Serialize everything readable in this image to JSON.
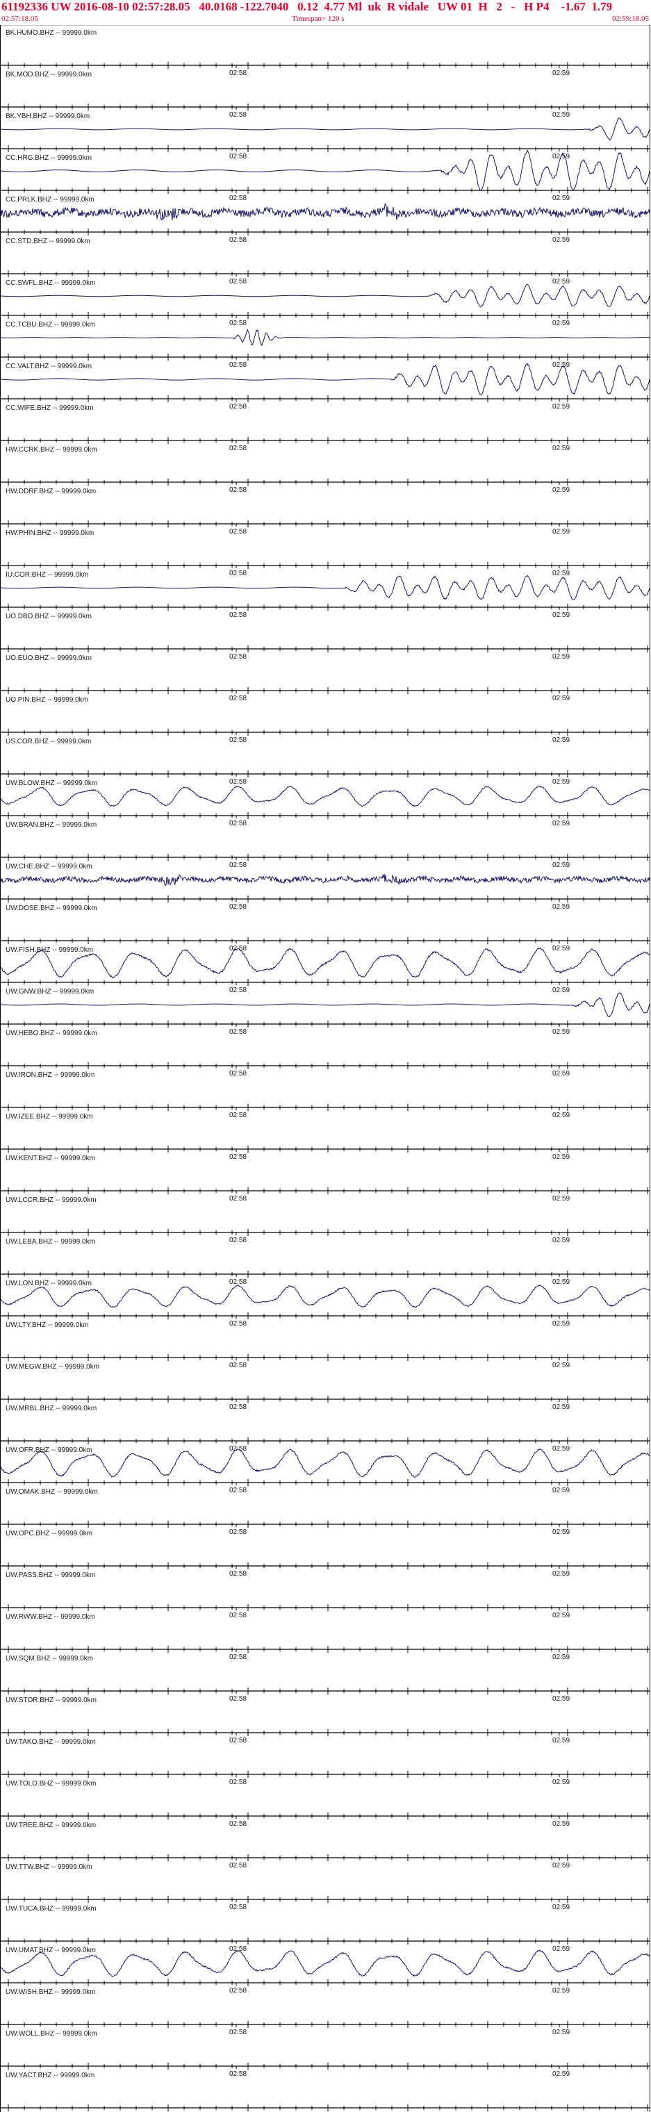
{
  "header": {
    "title": "61192336 UW 2016-08-10 02:57:28.05   40.0168 -122.7040   0.12  4.77 Ml  uk  R vidale   UW 01  H   2   -   H P4    -1.67  1.79",
    "start_time": "02:57:18.05",
    "timespan": "Timespan= 120 s",
    "end_time": "02:59:18.05"
  },
  "time_labels": [
    "02:58",
    "02:59"
  ],
  "colors": {
    "trace": "#141466",
    "header_text": "#e8002a",
    "axis": "#000000"
  },
  "channels": [
    {
      "label": "BK.HUMO.BHZ -- 99999.0km",
      "trace": "none",
      "amp": 0,
      "onset": 1.0
    },
    {
      "label": "BK.MOD.BHZ -- 99999.0km",
      "trace": "none",
      "amp": 0,
      "onset": 1.0
    },
    {
      "label": "BK.YBH.BHZ -- 99999.0km",
      "trace": "wave",
      "amp": 0.55,
      "onset": 0.9
    },
    {
      "label": "CC.HRG.BHZ -- 99999.0km",
      "trace": "wave",
      "amp": 0.9,
      "onset": 0.68
    },
    {
      "label": "CC.PRLK.BHZ -- 99999.0km",
      "trace": "noise",
      "amp": 0.45,
      "onset": 1.0
    },
    {
      "label": "CC.STD.BHZ -- 99999.0km",
      "trace": "none",
      "amp": 0,
      "onset": 1.0
    },
    {
      "label": "CC.SWFL.BHZ -- 99999.0km",
      "trace": "wave",
      "amp": 0.5,
      "onset": 0.66
    },
    {
      "label": "CC.TCBU.BHZ -- 99999.0km",
      "trace": "burst",
      "amp": 0.5,
      "onset": 0.36
    },
    {
      "label": "CC.VALT.BHZ -- 99999.0km",
      "trace": "wave",
      "amp": 0.7,
      "onset": 0.6
    },
    {
      "label": "CC.WIFE.BHZ -- 99999.0km",
      "trace": "none",
      "amp": 0,
      "onset": 1.0
    },
    {
      "label": "HW.CCRK.BHZ -- 99999.0km",
      "trace": "none",
      "amp": 0,
      "onset": 1.0
    },
    {
      "label": "HW.DDRF.BHZ -- 99999.0km",
      "trace": "none",
      "amp": 0,
      "onset": 1.0
    },
    {
      "label": "HW.PHIN.BHZ -- 99999.0km",
      "trace": "none",
      "amp": 0,
      "onset": 1.0
    },
    {
      "label": "IU.COR.BHZ -- 99999.0km",
      "trace": "wave",
      "amp": 0.55,
      "onset": 0.53
    },
    {
      "label": "UO.DBO.BHZ -- 99999.0km",
      "trace": "none",
      "amp": 0,
      "onset": 1.0
    },
    {
      "label": "UO.EUO.BHZ -- 99999.0km",
      "trace": "none",
      "amp": 0,
      "onset": 1.0
    },
    {
      "label": "UO.PIN.BHZ -- 99999.0km",
      "trace": "none",
      "amp": 0,
      "onset": 1.0
    },
    {
      "label": "US.COR.BHZ -- 99999.0km",
      "trace": "none",
      "amp": 0,
      "onset": 1.0
    },
    {
      "label": "UW.BLOW.BHZ -- 99999.0km",
      "trace": "micro",
      "amp": 0.55,
      "onset": 0.0
    },
    {
      "label": "UW.BRAN.BHZ -- 99999.0km",
      "trace": "none",
      "amp": 0,
      "onset": 1.0
    },
    {
      "label": "UW.CHE.BHZ -- 99999.0km",
      "trace": "noise",
      "amp": 0.3,
      "onset": 1.0
    },
    {
      "label": "UW.DOSE.BHZ -- 99999.0km",
      "trace": "none",
      "amp": 0,
      "onset": 1.0
    },
    {
      "label": "UW.FISH.BHZ -- 99999.0km",
      "trace": "micro",
      "amp": 0.8,
      "onset": 0.0
    },
    {
      "label": "UW.GNW.BHZ -- 99999.0km",
      "trace": "wave",
      "amp": 0.6,
      "onset": 0.88
    },
    {
      "label": "UW.HEBO.BHZ -- 99999.0km",
      "trace": "none",
      "amp": 0,
      "onset": 1.0
    },
    {
      "label": "UW.IRON.BHZ -- 99999.0km",
      "trace": "none",
      "amp": 0,
      "onset": 1.0
    },
    {
      "label": "UW.IZEE.BHZ -- 99999.0km",
      "trace": "none",
      "amp": 0,
      "onset": 1.0
    },
    {
      "label": "UW.KENT.BHZ -- 99999.0km",
      "trace": "none",
      "amp": 0,
      "onset": 1.0
    },
    {
      "label": "UW.LCCR.BHZ -- 99999.0km",
      "trace": "none",
      "amp": 0,
      "onset": 1.0
    },
    {
      "label": "UW.LEBA.BHZ -- 99999.0km",
      "trace": "none",
      "amp": 0,
      "onset": 1.0
    },
    {
      "label": "UW.LON.BHZ -- 99999.0km",
      "trace": "micro",
      "amp": 0.6,
      "onset": 0.0
    },
    {
      "label": "UW.LTY.BHZ -- 99999.0km",
      "trace": "none",
      "amp": 0,
      "onset": 1.0
    },
    {
      "label": "UW.MEGW.BHZ -- 99999.0km",
      "trace": "none",
      "amp": 0,
      "onset": 1.0
    },
    {
      "label": "UW.MRBL.BHZ -- 99999.0km",
      "trace": "none",
      "amp": 0,
      "onset": 1.0
    },
    {
      "label": "UW.OFR.BHZ -- 99999.0km",
      "trace": "micro",
      "amp": 0.75,
      "onset": 0.0
    },
    {
      "label": "UW.OMAK.BHZ -- 99999.0km",
      "trace": "none",
      "amp": 0,
      "onset": 1.0
    },
    {
      "label": "UW.OPC.BHZ -- 99999.0km",
      "trace": "none",
      "amp": 0,
      "onset": 1.0
    },
    {
      "label": "UW.PASS.BHZ -- 99999.0km",
      "trace": "none",
      "amp": 0,
      "onset": 1.0
    },
    {
      "label": "UW.RWW.BHZ -- 99999.0km",
      "trace": "none",
      "amp": 0,
      "onset": 1.0
    },
    {
      "label": "UW.SQM.BHZ -- 99999.0km",
      "trace": "none",
      "amp": 0,
      "onset": 1.0
    },
    {
      "label": "UW.STOR.BHZ -- 99999.0km",
      "trace": "none",
      "amp": 0,
      "onset": 1.0
    },
    {
      "label": "UW.TAKO.BHZ -- 99999.0km",
      "trace": "none",
      "amp": 0,
      "onset": 1.0
    },
    {
      "label": "UW.TOLO.BHZ -- 99999.0km",
      "trace": "none",
      "amp": 0,
      "onset": 1.0
    },
    {
      "label": "UW.TREE.BHZ -- 99999.0km",
      "trace": "none",
      "amp": 0,
      "onset": 1.0
    },
    {
      "label": "UW.TTW.BHZ -- 99999.0km",
      "trace": "none",
      "amp": 0,
      "onset": 1.0
    },
    {
      "label": "UW.TUCA.BHZ -- 99999.0km",
      "trace": "none",
      "amp": 0,
      "onset": 1.0
    },
    {
      "label": "UW.UMAT.BHZ -- 99999.0km",
      "trace": "micro",
      "amp": 0.7,
      "onset": 0.0
    },
    {
      "label": "UW.WISH.BHZ -- 99999.0km",
      "trace": "none",
      "amp": 0,
      "onset": 1.0
    },
    {
      "label": "UW.WOLL.BHZ -- 99999.0km",
      "trace": "none",
      "amp": 0,
      "onset": 1.0
    },
    {
      "label": "UW.YACT.BHZ -- 99999.0km",
      "trace": "none",
      "amp": 0,
      "onset": 1.0
    }
  ]
}
